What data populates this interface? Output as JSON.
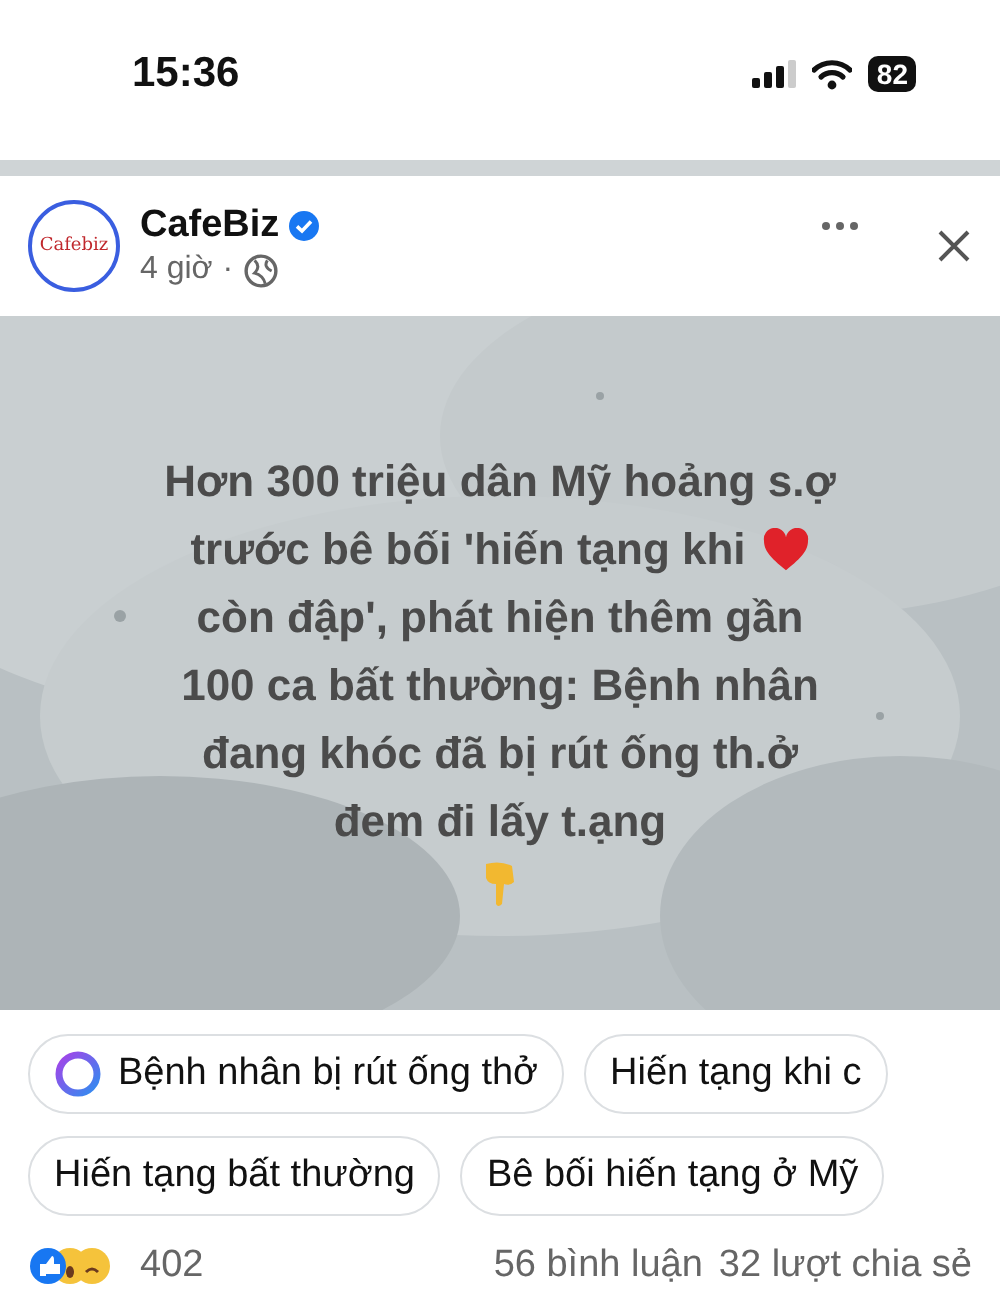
{
  "status_bar": {
    "time": "15:36",
    "battery": "82"
  },
  "post": {
    "author": "CafeBiz",
    "verified": true,
    "time": "4 giờ",
    "separator": "·",
    "logo_text": "Cafebiz"
  },
  "image": {
    "kind": "picture",
    "headline_lines": [
      {
        "text": "Hơn 300 triệu dân Mỹ hoảng s.ợ",
        "kind": "plain"
      },
      {
        "text": "trước bê bối 'hiến tạng khi",
        "kind": "heart"
      },
      {
        "text": "còn đập', phát hiện thêm gần",
        "kind": "plain"
      },
      {
        "text": "100 ca bất thường: Bệnh nhân",
        "kind": "plain"
      },
      {
        "text": "đang khóc đã bị rút ống th.ở",
        "kind": "plain"
      },
      {
        "text": "đem đi lấy t.ạng",
        "kind": "plain"
      }
    ]
  },
  "chips": [
    [
      {
        "label": "Bệnh nhân bị rút ống thở",
        "kind": "ai"
      },
      {
        "label": "Hiến tạng khi c",
        "kind": "plain"
      }
    ],
    [
      {
        "label": "Hiến tạng bất thường",
        "kind": "plain"
      },
      {
        "label": "Bê bối hiến tạng ở Mỹ",
        "kind": "plain"
      }
    ]
  ],
  "stats": {
    "reactions": "402",
    "comments": "56 bình luận",
    "shares": "32 lượt chia sẻ"
  }
}
